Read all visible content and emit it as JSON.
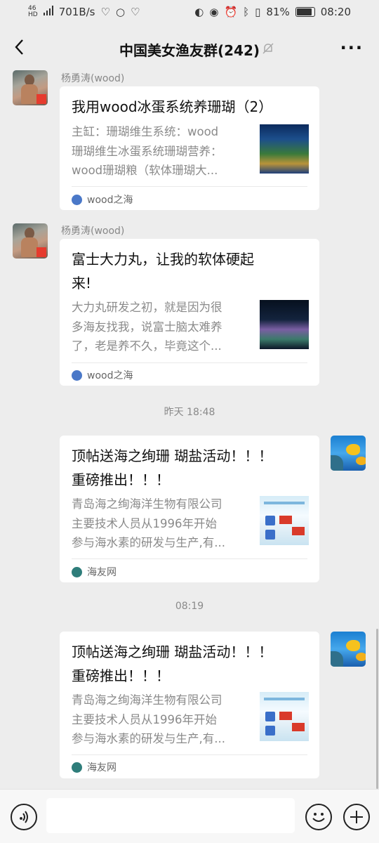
{
  "status_bar": {
    "network_top": "46",
    "network_bottom": "HD",
    "speed": "701B/s",
    "battery": "81%",
    "battery_level": 0.81,
    "time": "08:20"
  },
  "header": {
    "title": "中国美女渔友群(242)",
    "more_label": "···"
  },
  "messages": [
    {
      "sender": "杨勇涛(wood)",
      "title_lines": [
        "我用wood冰蛋系统养珊瑚（2）"
      ],
      "desc_lines": [
        "主缸：珊瑚维生系统：wood",
        "珊瑚维生冰蛋系统珊瑚营养：",
        "wood珊瑚粮（软体珊瑚大..."
      ],
      "source": "wood之海"
    },
    {
      "sender": "杨勇涛(wood)",
      "title_lines": [
        "富士大力丸，让我的软体硬起",
        "来!"
      ],
      "desc_lines": [
        "大力丸研发之初，就是因为很",
        "多海友找我，说富士脑太难养",
        "了，老是养不久，毕竟这个..."
      ],
      "source": "wood之海"
    },
    {
      "timestamp": "昨天 18:48"
    },
    {
      "title_lines": [
        "顶帖送海之绚珊 瑚盐活动！！！",
        "重磅推出！！！"
      ],
      "desc_lines": [
        "青岛海之绚海洋生物有限公司",
        "主要技术人员从1996年开始",
        "参与海水素的研发与生产,有..."
      ],
      "source": "海友网"
    },
    {
      "timestamp": "08:19"
    },
    {
      "title_lines": [
        "顶帖送海之绚珊 瑚盐活动！！！",
        "重磅推出！！！"
      ],
      "desc_lines": [
        "青岛海之绚海洋生物有限公司",
        "主要技术人员从1996年开始",
        "参与海水素的研发与生产,有..."
      ],
      "source": "海友网"
    }
  ],
  "input_bar": {
    "placeholder": ""
  },
  "colors": {
    "background": "#ededed",
    "card": "#ffffff",
    "muted_text": "#8a8a8a",
    "flag_red": "#e63b2e"
  }
}
